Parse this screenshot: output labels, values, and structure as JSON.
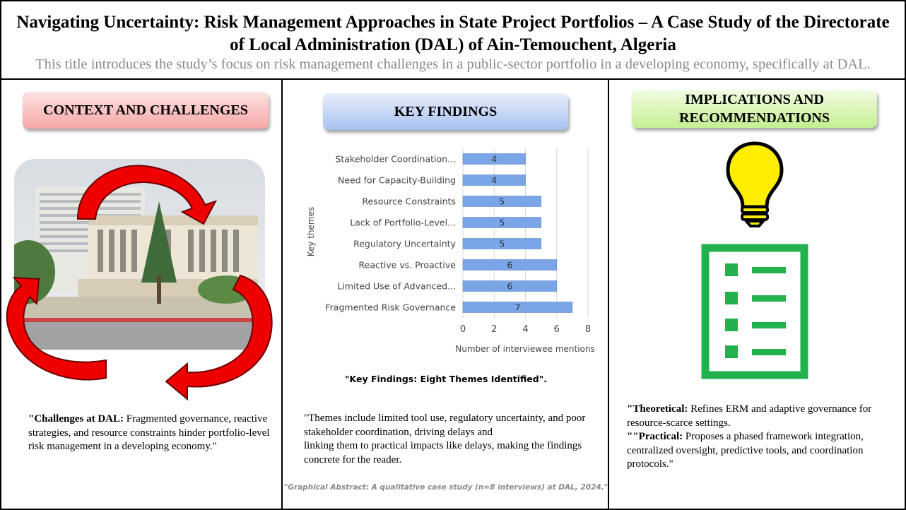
{
  "header": {
    "title": "Navigating Uncertainty: Risk Management Approaches in State Project Portfolios – A Case Study of the Directorate of Local Administration (DAL) of Ain-Temouchent, Algeria",
    "subtitle": "This title introduces the study’s focus on risk management challenges in a public-sector portfolio in a developing economy, specifically at DAL."
  },
  "left": {
    "heading": "CONTEXT AND CHALLENGES",
    "text_lead": "\"Challenges at DAL:",
    "text_body": " Fragmented governance, reactive strategies, and resource constraints hinder portfolio-level risk management in a developing economy.\""
  },
  "middle": {
    "heading": "KEY FINDINGS",
    "caption": "\"Key Findings: Eight Themes Identified\".",
    "text_line1": "\"Themes include limited tool use, regulatory uncertainty, and poor stakeholder coordination, driving delays and",
    "text_line2": "linking them to practical impacts like delays, making the findings concrete for the reader.",
    "footnote": "\"Graphical Abstract: A qualitative case study (n=8 interviews) at DAL, 2024.\""
  },
  "right": {
    "heading": "IMPLICATIONS AND RECOMMENDATIONS",
    "theoretical_lead": "\"Theoretical:",
    "theoretical_body": " Refines ERM and adaptive governance for resource-scarce settings.",
    "practical_lead": "\"\"Practical:",
    "practical_body": " Proposes a phased framework integration, centralized oversight, predictive tools, and coordination protocols.\""
  },
  "colors": {
    "bar": "#7aa6e8",
    "arrow": "#ee0000",
    "bulb": "#ffee00",
    "checklist": "#22b14c"
  },
  "chart_data": {
    "type": "bar",
    "orientation": "horizontal",
    "categories": [
      "Stakeholder Coordination...",
      "Need for Capacity-Building",
      "Resource Constraints",
      "Lack of Portfolio-Level...",
      "Regulatory Uncertainty",
      "Reactive vs. Proactive",
      "Limited Use of Advanced...",
      "Fragmented Risk Governance"
    ],
    "values": [
      4,
      4,
      5,
      5,
      5,
      6,
      6,
      7
    ],
    "xlabel": "Number of interviewee mentions",
    "ylabel": "Key themes",
    "xlim": [
      0,
      8
    ],
    "xticks": [
      "0",
      "2",
      "4",
      "6",
      "8"
    ],
    "grid": true,
    "data_labels": true
  }
}
